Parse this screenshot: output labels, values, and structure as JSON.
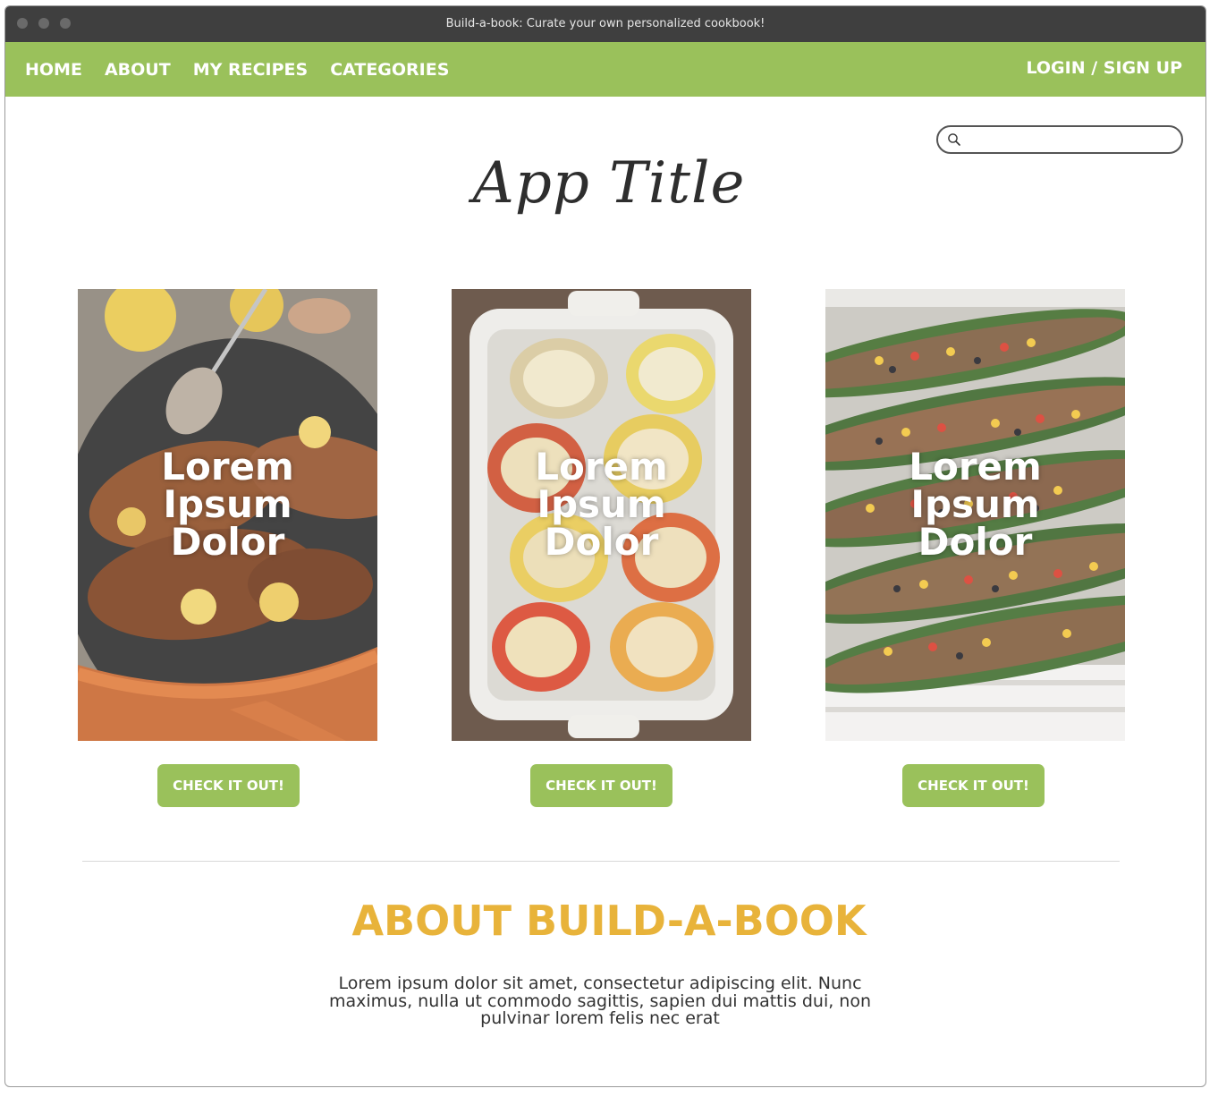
{
  "window": {
    "title": "Build-a-book: Curate your own personalized cookbook!"
  },
  "nav": {
    "items": [
      {
        "label": "HOME"
      },
      {
        "label": "ABOUT"
      },
      {
        "label": "MY RECIPES"
      },
      {
        "label": "CATEGORIES"
      }
    ],
    "login_label": "LOGIN / SIGN UP"
  },
  "search": {
    "placeholder": "",
    "icon": "search-icon"
  },
  "app_title": "App Title",
  "cards": [
    {
      "title": "Lorem\nIpsum\nDolor",
      "button": "CHECK IT OUT!",
      "image": "glazed-salmon-skillet"
    },
    {
      "title": "Lorem\nIpsum\nDolor",
      "button": "CHECK IT OUT!",
      "image": "stuffed-peppers-dish"
    },
    {
      "title": "Lorem\nIpsum\nDolor",
      "button": "CHECK IT OUT!",
      "image": "stuffed-zucchini-boats"
    }
  ],
  "about": {
    "heading": "ABOUT BUILD-A-BOOK",
    "body": "Lorem ipsum dolor sit amet, consectetur adipiscing elit. Nunc maximus, nulla ut commodo sagittis, sapien dui mattis dui, non pulvinar lorem felis nec erat"
  },
  "colors": {
    "nav_green": "#9ac15b",
    "heading_gold": "#e8b33a",
    "titlebar": "#3f3f3f"
  }
}
